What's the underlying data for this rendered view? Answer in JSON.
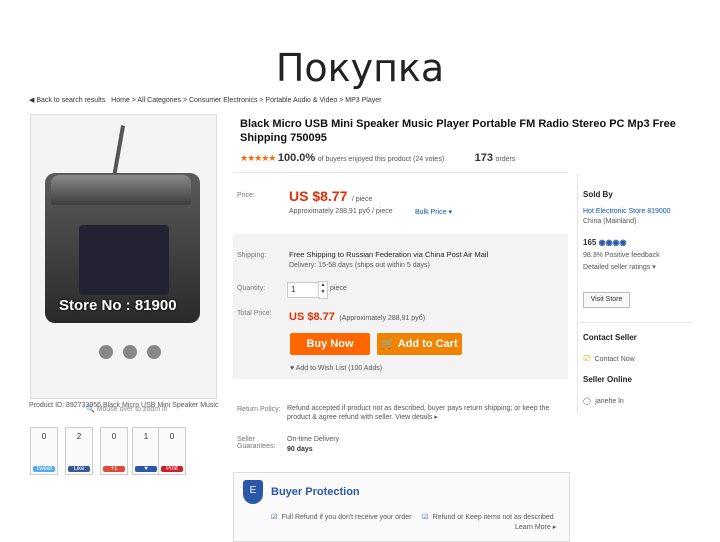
{
  "slide_title": "Покупка",
  "breadcrumb": {
    "back": "◀ Back to search results",
    "path": "Home > All Categories > Consumer Electronics > Portable Audio & Video > MP3 Player"
  },
  "gallery": {
    "watermark": "Store No : 81900",
    "hint": "🔍 Mouse over to zoom in",
    "product_id": "Product ID: 892733956 Black Micro USB Mini Speaker Music"
  },
  "social": [
    {
      "count": "0",
      "label": "Tweet",
      "color": "#55acee"
    },
    {
      "count": "2",
      "label": "Like",
      "color": "#3b5998"
    },
    {
      "count": "0",
      "label": "+1",
      "color": "#dd4b39"
    },
    {
      "count": "1",
      "label": "♥",
      "color": "#2b57a8"
    },
    {
      "count": "0",
      "label": "Pinit",
      "color": "#cb2027"
    }
  ],
  "product": {
    "title": "Black Micro USB Mini Speaker Music Player Portable FM Radio Stereo PC Mp3 Free Shipping 750095",
    "stars": "★★★★★",
    "percent": "100.0%",
    "percent_note": "of buyers enjoyed this product (24 votes)",
    "orders": "173",
    "orders_label": "orders"
  },
  "pricing": {
    "price_label": "Price:",
    "price": "US $8.77",
    "price_unit": "/ piece",
    "approx": "Approximately 288,91 руб / piece",
    "bulk": "Bulk Price ▾",
    "shipping_label": "Shipping:",
    "shipping": "Free Shipping to Russian Federation via China Post Air Mail",
    "delivery": "Delivery: 15-58 days (ships out within 5 days)",
    "quantity_label": "Quantity:",
    "quantity": "1",
    "quantity_unit": "piece",
    "total_label": "Total Price:",
    "total": "US $8.77",
    "total_approx": "(Approximately 288,91 руб)",
    "buy_now": "Buy Now",
    "add_to_cart": "🛒 Add to Cart",
    "wishlist": "♥ Add to Wish List (100 Adds)"
  },
  "policy": {
    "return_label": "Return Policy:",
    "return_text": "Refund accepted if product not as described, buyer pays return shipping; or keep the product & agree refund with seller. View details ▸",
    "guarantee_label": "Seller Guarantees:",
    "guarantee_text": "On-time Delivery",
    "guarantee_days": "90 days"
  },
  "seller": {
    "sold_by": "Sold By",
    "store": "Hot Electronic Store 819000",
    "location": "China (Mainland)",
    "score": "165",
    "feedback": "98.3% Positive feedback",
    "ratings": "Detailed seller ratings ▾",
    "visit": "Visit Store",
    "contact_head": "Contact Seller",
    "contact_now": "Contact Now",
    "online_head": "Seller Online",
    "online_name": "janehe ln"
  },
  "protection": {
    "title": "Buyer Protection",
    "full_refund": "Full Refund if you don't receive your order",
    "partial_refund": "Refund or Keep items not as described",
    "learn_more": "Learn More ▸"
  }
}
